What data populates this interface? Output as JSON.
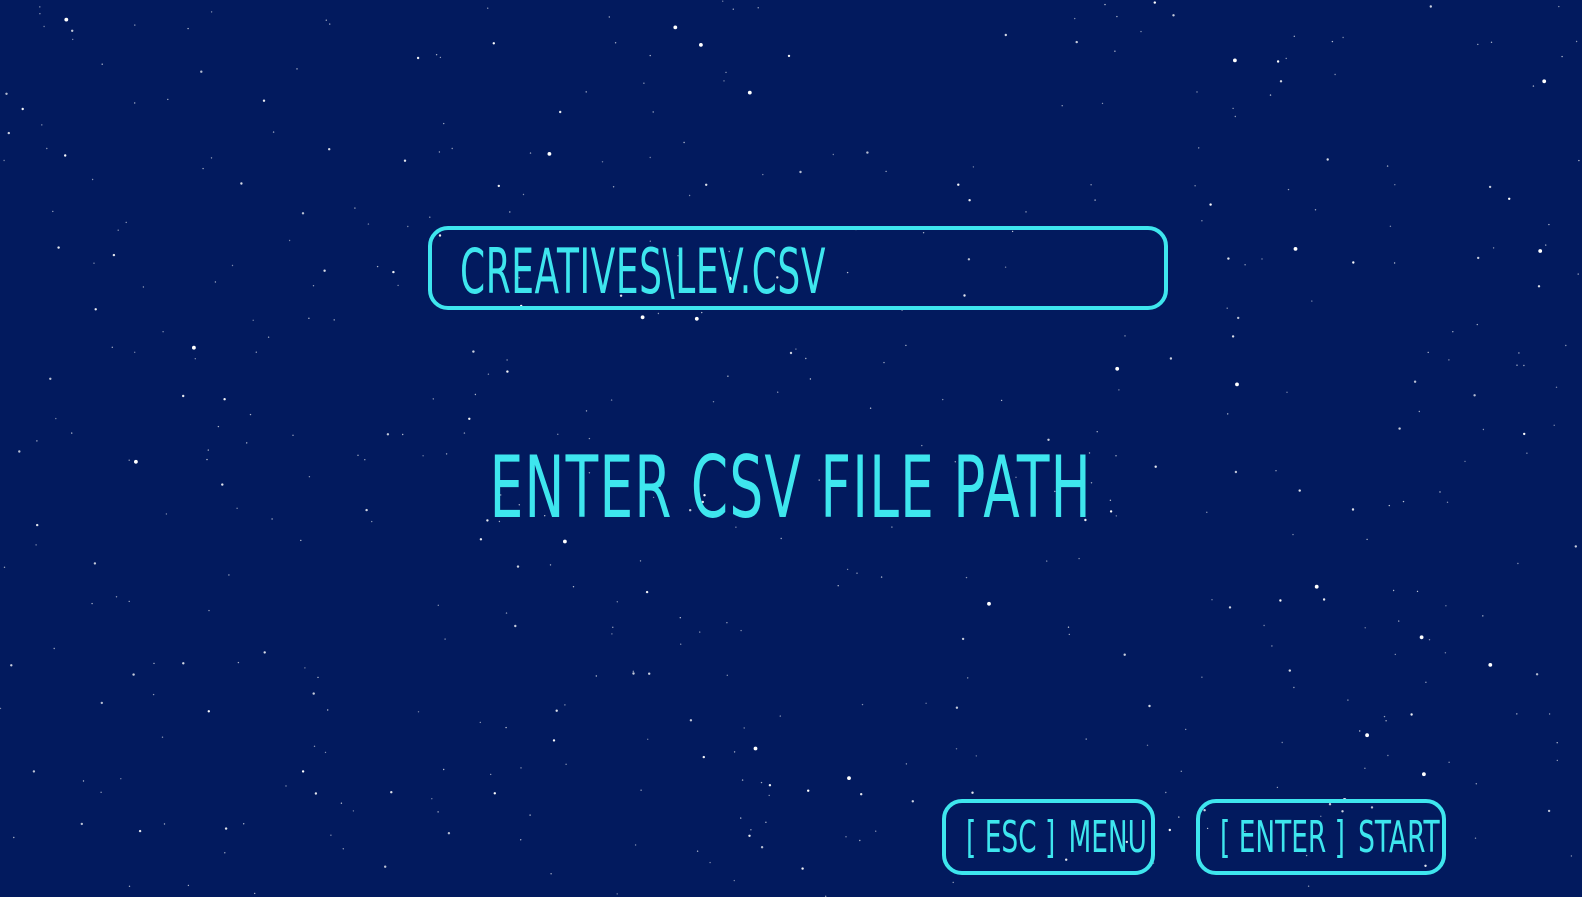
{
  "screen": {
    "background_color": "#021a5e",
    "accent_color": "#3ee6ee",
    "star_color": "#ffffff"
  },
  "path_input": {
    "value": "CREATIVES\\LEV.CSV"
  },
  "prompt": {
    "text": "ENTER CSV FILE PATH"
  },
  "controls": {
    "menu": {
      "key": "[ ESC ]",
      "label": "MENU"
    },
    "start": {
      "key": "[ ENTER ]",
      "label": "START"
    }
  }
}
